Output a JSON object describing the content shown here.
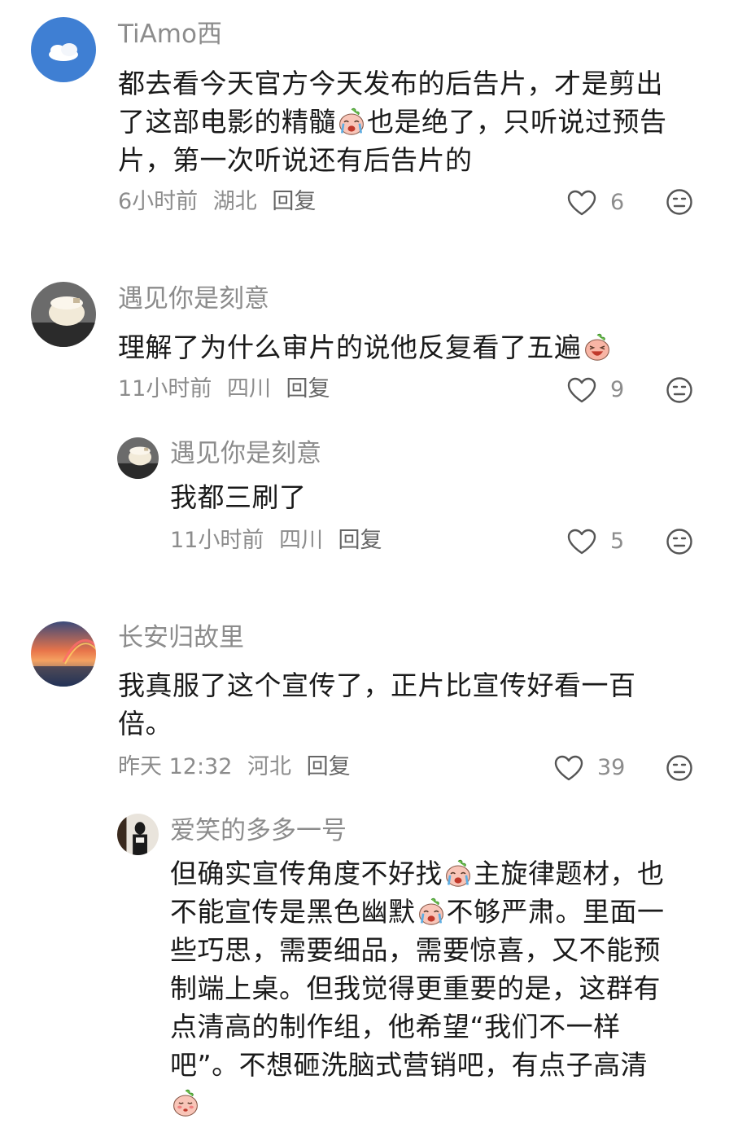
{
  "comments": [
    {
      "username": "TiAmo西",
      "lines": [
        "都去看今天官方今天发布的后告片，才是剪出",
        "了这部电影的精髓",
        "也是绝了，只听说过预告",
        "片，第一次听说还有后告片的"
      ],
      "time": "6小时前",
      "location": "湖北",
      "reply": "回复",
      "likes": "6"
    },
    {
      "username": "遇见你是刻意",
      "lines": [
        "理解了为什么审片的说他反复看了五遍"
      ],
      "time": "11小时前",
      "location": "四川",
      "reply": "回复",
      "likes": "9"
    },
    {
      "username": "遇见你是刻意",
      "lines": [
        "我都三刷了"
      ],
      "time": "11小时前",
      "location": "四川",
      "reply": "回复",
      "likes": "5"
    },
    {
      "username": "长安归故里",
      "lines": [
        "我真服了这个宣传了，正片比宣传好看一百",
        "倍。"
      ],
      "time": "昨天 12:32",
      "location": "河北",
      "reply": "回复",
      "likes": "39"
    },
    {
      "username": "爱笑的多多一号",
      "lines": [
        "但确实宣传角度不好找",
        "主旋律题材，也",
        "不能宣传是黑色幽默",
        "不够严肃。里面一",
        "些巧思，需要细品，需要惊喜，又不能预",
        "制端上桌。但我觉得更重要的是，这群有",
        "点清高的制作组，他希望“我们不一样",
        "吧”。不想砸洗脑式营销吧，有点子高清"
      ]
    }
  ],
  "icons": {
    "like": "heart-outline-icon",
    "dislike": "neutral-face-icon",
    "emoji_cry": "crying-peach-emoji",
    "emoji_laugh": "laughing-peach-emoji",
    "emoji_shy": "shy-peach-emoji"
  },
  "colors": {
    "meta_gray": "#8c8c8c",
    "text": "#1a1a1a"
  }
}
